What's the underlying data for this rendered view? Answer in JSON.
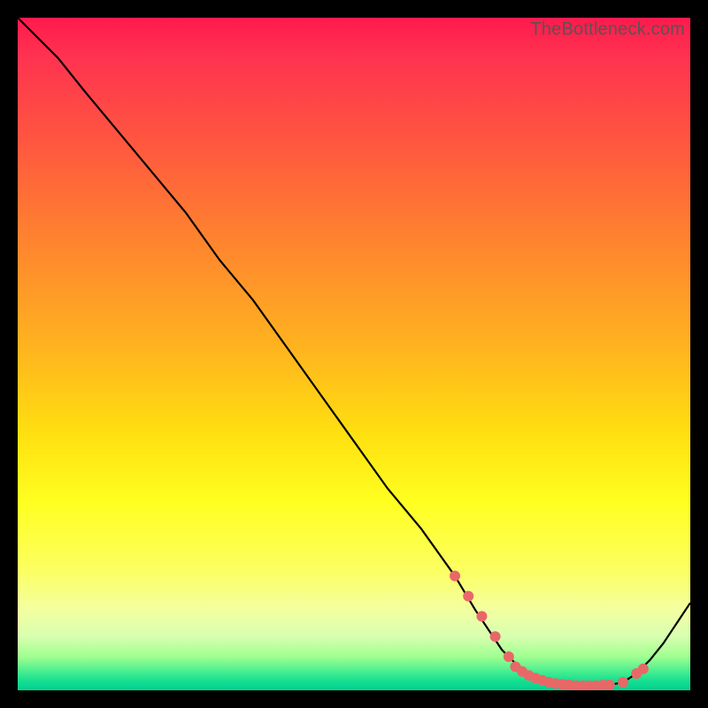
{
  "watermark": "TheBottleneck.com",
  "chart_data": {
    "type": "line",
    "title": "",
    "xlabel": "",
    "ylabel": "",
    "xlim": [
      0,
      100
    ],
    "ylim": [
      0,
      100
    ],
    "grid": false,
    "background_gradient": {
      "top": "#ff1a4d",
      "middle": "#ffe010",
      "bottom": "#00d090"
    },
    "series": [
      {
        "name": "bottleneck-curve",
        "stroke": "#000000",
        "x": [
          0,
          6,
          10,
          15,
          20,
          25,
          30,
          35,
          40,
          45,
          50,
          55,
          60,
          65,
          68,
          70,
          72,
          74,
          76,
          78,
          80,
          82,
          84,
          86,
          88,
          90,
          92,
          94,
          96,
          98,
          100
        ],
        "y": [
          100,
          94,
          89,
          83,
          77,
          71,
          64,
          58,
          51,
          44,
          37,
          30,
          24,
          17,
          12,
          9,
          6,
          4,
          2.5,
          1.5,
          1,
          0.8,
          0.7,
          0.7,
          0.8,
          1.2,
          2.5,
          4.5,
          7,
          10,
          13
        ]
      }
    ],
    "highlight_points": {
      "name": "optimal-range",
      "fill": "#e86868",
      "x": [
        65,
        67,
        69,
        71,
        73,
        74,
        75,
        76,
        77,
        78,
        79,
        80,
        81,
        82,
        83,
        84,
        85,
        86,
        87,
        88,
        90,
        92,
        93
      ],
      "y": [
        17,
        14,
        11,
        8,
        5,
        3.5,
        2.8,
        2.2,
        1.8,
        1.5,
        1.2,
        1.0,
        0.9,
        0.8,
        0.7,
        0.7,
        0.7,
        0.7,
        0.8,
        0.8,
        1.2,
        2.5,
        3.2
      ]
    }
  }
}
